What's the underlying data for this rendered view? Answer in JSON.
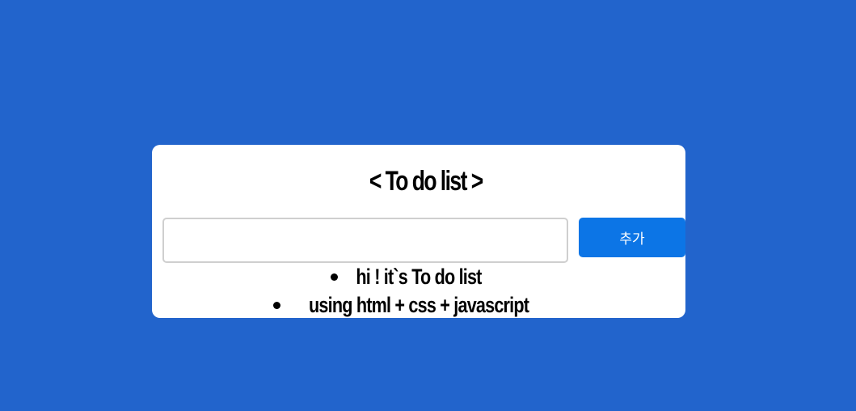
{
  "title": "< To do list >",
  "input": {
    "value": "",
    "placeholder": ""
  },
  "add_button_label": "추가",
  "todos": [
    "hi ! it`s To do list",
    "using html + css + javascript"
  ],
  "colors": {
    "background": "#2264cc",
    "card": "#ffffff",
    "button": "#0c75e6",
    "input_border": "#cfcfcf"
  }
}
